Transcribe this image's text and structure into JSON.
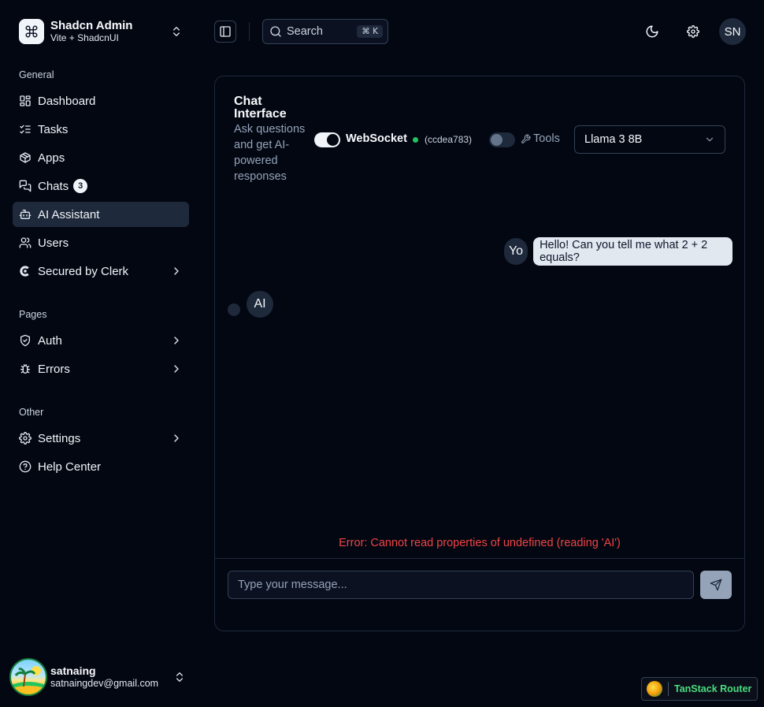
{
  "team": {
    "name": "Shadcn Admin",
    "plan": "Vite + ShadcnUI"
  },
  "sidebar": {
    "groups": [
      {
        "label": "General"
      },
      {
        "label": "Pages"
      },
      {
        "label": "Other"
      }
    ],
    "items": [
      {
        "label": "Dashboard",
        "icon": "layout-dashboard-icon"
      },
      {
        "label": "Tasks",
        "icon": "list-checks-icon"
      },
      {
        "label": "Apps",
        "icon": "package-icon"
      },
      {
        "label": "Chats",
        "icon": "messages-icon",
        "badge": "3"
      },
      {
        "label": "AI Assistant",
        "icon": "bot-icon",
        "active": true
      },
      {
        "label": "Users",
        "icon": "users-icon"
      },
      {
        "label": "Secured by Clerk",
        "icon": "clerk-icon",
        "expandable": true
      },
      {
        "label": "Auth",
        "icon": "shield-check-icon",
        "expandable": true
      },
      {
        "label": "Errors",
        "icon": "bug-icon",
        "expandable": true
      },
      {
        "label": "Settings",
        "icon": "settings-icon",
        "expandable": true
      },
      {
        "label": "Help Center",
        "icon": "help-circle-icon"
      }
    ]
  },
  "user": {
    "name": "satnaing",
    "email": "satnaingdev@gmail.com"
  },
  "header": {
    "search_placeholder": "Search",
    "search_shortcut": "⌘ K",
    "avatar_initials": "SN"
  },
  "chat": {
    "title": "Chat Interface",
    "description": "Ask questions and get AI-powered responses",
    "websocket_label": "WebSocket",
    "websocket_enabled": true,
    "connection_status_color": "#22c55e",
    "connection_id": "(ccdea783)",
    "tools_label": "Tools",
    "tools_enabled": false,
    "model": "Llama 3 8B",
    "messages": [
      {
        "role": "user",
        "avatar": "Yo",
        "text": "Hello! Can you tell me what 2 + 2 equals?"
      },
      {
        "role": "assistant",
        "avatar": "AI",
        "text": ""
      }
    ],
    "error": "Error: Cannot read properties of undefined (reading 'AI')",
    "input_placeholder": "Type your message..."
  },
  "devtools": {
    "label": "TanStack Router"
  },
  "colors": {
    "background": "#030712",
    "accent": "#f1f5f9",
    "error": "#ef4444",
    "status_online": "#22c55e"
  }
}
